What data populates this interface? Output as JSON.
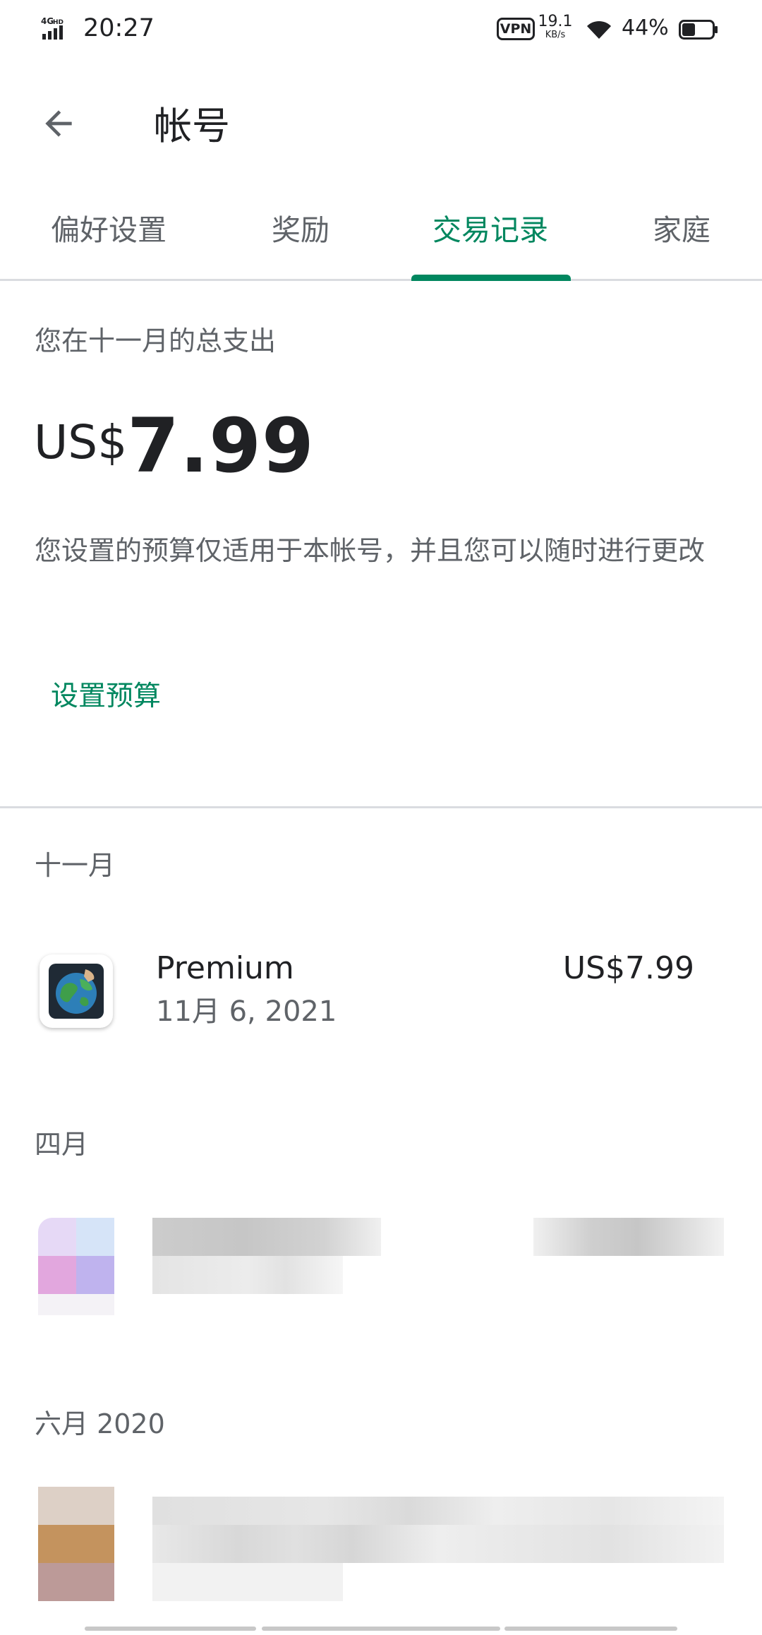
{
  "status_bar": {
    "network": "4G HD",
    "time": "20:27",
    "vpn": "VPN",
    "speed_value": "19.1",
    "speed_unit": "KB/s",
    "battery_percent": "44%",
    "battery_level": 0.44
  },
  "app_bar": {
    "back_icon": "arrow-back-icon",
    "title": "帐号"
  },
  "tabs": [
    {
      "label": "偏好设置",
      "active": false
    },
    {
      "label": "奖励",
      "active": false
    },
    {
      "label": "交易记录",
      "active": true
    },
    {
      "label": "家庭",
      "active": false
    }
  ],
  "summary": {
    "caption": "您在十一月的总支出",
    "currency": "US$",
    "amount": "7.99",
    "budget_note": "您设置的预算仅适用于本帐号，并且您可以随时进行更改",
    "budget_link": "设置预算"
  },
  "months": [
    {
      "label": "十一月",
      "transactions": [
        {
          "title": "Premium",
          "date": "11月 6, 2021",
          "price": "US$7.99",
          "icon": "globe-app-icon"
        }
      ]
    },
    {
      "label": "四月",
      "transactions": []
    },
    {
      "label": "六月 2020",
      "transactions": []
    }
  ],
  "colors": {
    "accent": "#01875f",
    "text_primary": "#202124",
    "text_secondary": "#5f6368",
    "divider": "#dadce0"
  }
}
